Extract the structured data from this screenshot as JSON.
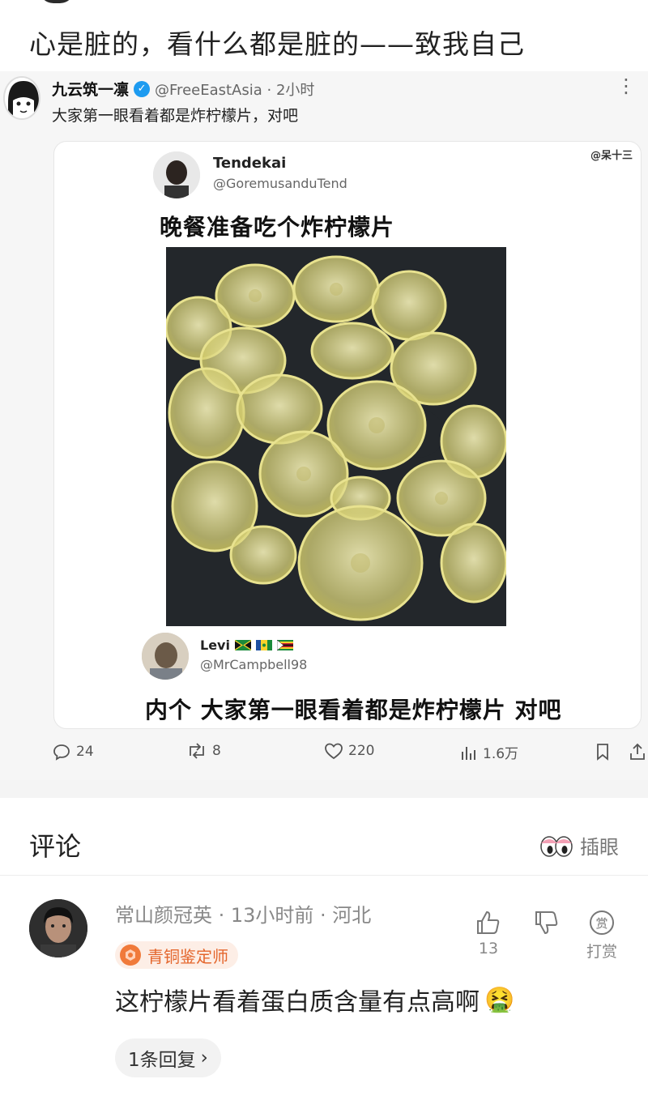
{
  "post": {
    "title": "心是脏的，看什么都是脏的——致我自己"
  },
  "tweet": {
    "author_name": "九云筑一凛",
    "author_handle": "@FreeEastAsia · 2小时",
    "text": "大家第一眼看着都是炸柠檬片，对吧",
    "more_icon": "more-dots-icon",
    "embed": {
      "watermark": "@呆十三",
      "quoted_name": "Tendekai",
      "quoted_handle": "@GoremusanduTend",
      "quoted_text": "晚餐准备吃个炸柠檬片",
      "reply_name": "Levi",
      "reply_handle": "@MrCampbell98",
      "reply_text": "内个 大家第一眼看着都是炸柠檬片 对吧"
    },
    "stats": {
      "replies": "24",
      "retweets": "8",
      "likes": "220",
      "views": "1.6万"
    },
    "colors": {
      "verified": "#1d9bf0"
    }
  },
  "comments": {
    "header": "评论",
    "sort_label": "插眼",
    "items": [
      {
        "user": "常山颜冠英",
        "meta": " · 13小时前 · 河北",
        "badge": "青铜鉴定师",
        "text": "这柠檬片看着蛋白质含量有点高啊",
        "emoji": "🤮",
        "likes": "13",
        "reward_label": "打赏",
        "reward_icon_text": "赏",
        "reply_label": "1条回复"
      }
    ],
    "colors": {
      "badge_fg": "#e4662c",
      "badge_bg": "#fdeee6"
    }
  }
}
